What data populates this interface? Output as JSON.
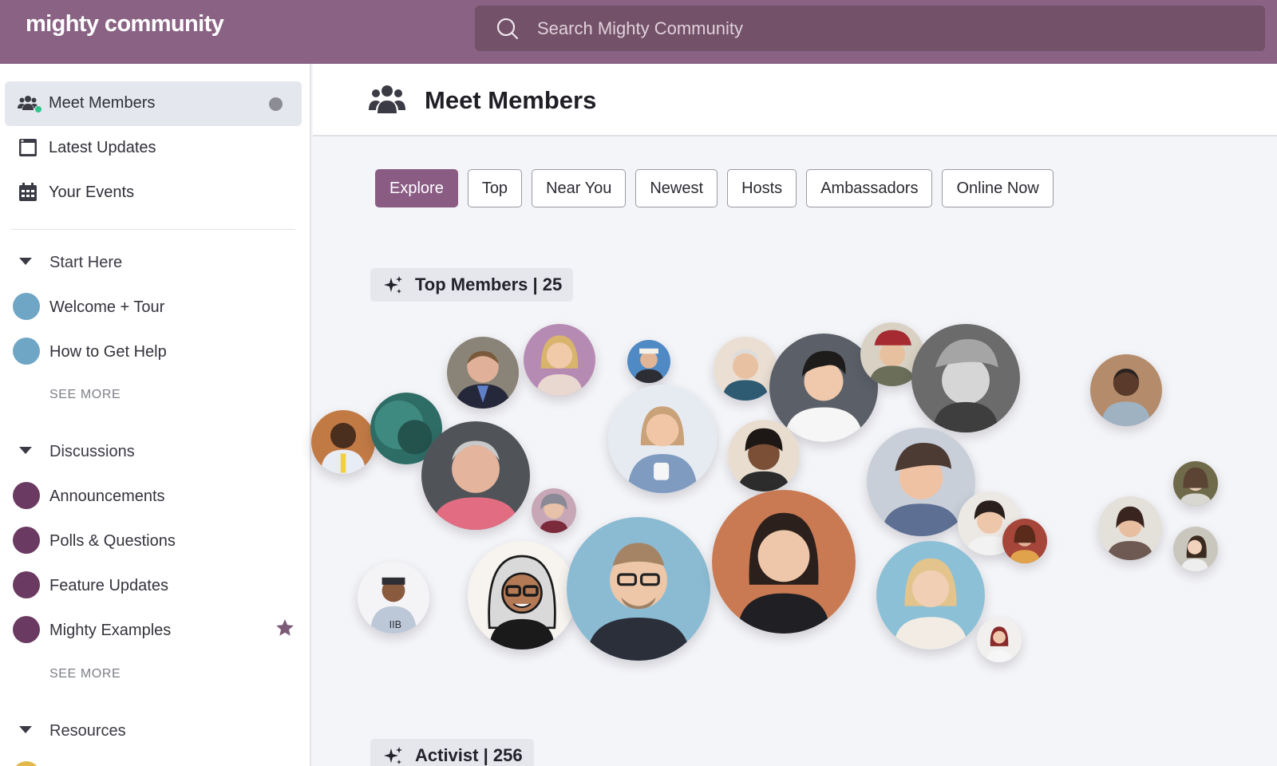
{
  "app": {
    "brand": "mighty community",
    "search_placeholder": "Search Mighty Community"
  },
  "sidebar": {
    "nav": [
      {
        "label": "Meet Members",
        "icon": "users-icon",
        "active": true
      },
      {
        "label": "Latest Updates",
        "icon": "newspaper-icon"
      },
      {
        "label": "Your Events",
        "icon": "calendar-icon"
      }
    ],
    "sections": [
      {
        "title": "Start Here",
        "items": [
          {
            "label": "Welcome + Tour"
          },
          {
            "label": "How to Get Help"
          }
        ],
        "see_more": "SEE MORE"
      },
      {
        "title": "Discussions",
        "items": [
          {
            "label": "Announcements"
          },
          {
            "label": "Polls & Questions"
          },
          {
            "label": "Feature Updates"
          },
          {
            "label": "Mighty Examples",
            "starred": true
          }
        ],
        "see_more": "SEE MORE"
      },
      {
        "title": "Resources"
      }
    ]
  },
  "main": {
    "title": "Meet Members",
    "tabs": [
      "Explore",
      "Top",
      "Near You",
      "Newest",
      "Hosts",
      "Ambassadors",
      "Online Now"
    ],
    "active_tab": "Explore",
    "top_members": {
      "label": "Top Members | 25"
    },
    "activist": {
      "label": "Activist | 256"
    }
  },
  "colors": {
    "brand": "#8a6384",
    "active_tab": "#8a5c84",
    "start_here_dot": "#6fa6c6",
    "discussion_dot": "#6b3a62",
    "online": "#31c48d"
  }
}
